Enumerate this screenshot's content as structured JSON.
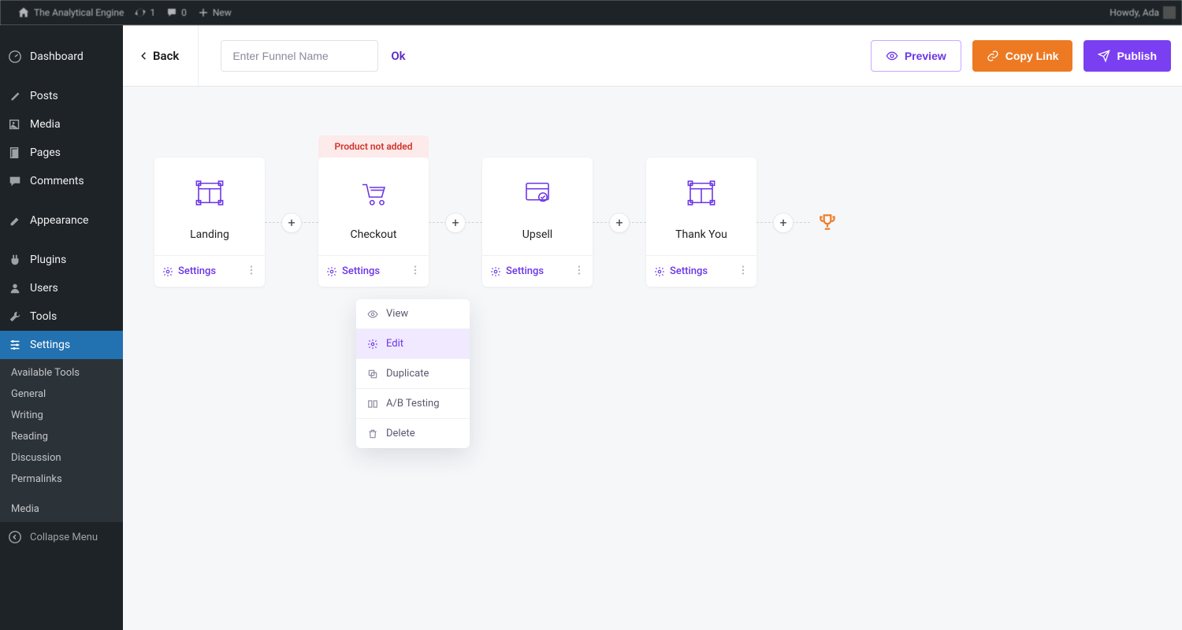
{
  "adminbar": {
    "site_name": "The Analytical Engine",
    "updates_count": "1",
    "comments_count": "0",
    "new_label": "New",
    "greeting": "Howdy, Ada"
  },
  "sidebar": {
    "items": [
      {
        "label": "Dashboard"
      },
      {
        "label": "Posts"
      },
      {
        "label": "Media"
      },
      {
        "label": "Pages"
      },
      {
        "label": "Comments"
      },
      {
        "label": "Appearance"
      },
      {
        "label": "Plugins"
      },
      {
        "label": "Users"
      },
      {
        "label": "Tools"
      },
      {
        "label": "Settings"
      }
    ],
    "submenu": [
      "Available Tools",
      "General",
      "Writing",
      "Reading",
      "Discussion",
      "Permalinks"
    ],
    "submenu_extra": "Media",
    "collapse_label": "Collapse Menu"
  },
  "header": {
    "back_label": "Back",
    "name_placeholder": "Enter Funnel Name",
    "ok_label": "Ok",
    "preview_label": "Preview",
    "copy_label": "Copy Link",
    "publish_label": "Publish"
  },
  "steps": [
    {
      "title": "Landing",
      "settings_label": "Settings"
    },
    {
      "title": "Checkout",
      "settings_label": "Settings",
      "badge": "Product not added"
    },
    {
      "title": "Upsell",
      "settings_label": "Settings"
    },
    {
      "title": "Thank You",
      "settings_label": "Settings"
    }
  ],
  "popover": {
    "items": [
      {
        "label": "View"
      },
      {
        "label": "Edit"
      },
      {
        "label": "Duplicate"
      },
      {
        "label": "A/B Testing"
      },
      {
        "label": "Delete"
      }
    ],
    "highlight_index": 1
  }
}
